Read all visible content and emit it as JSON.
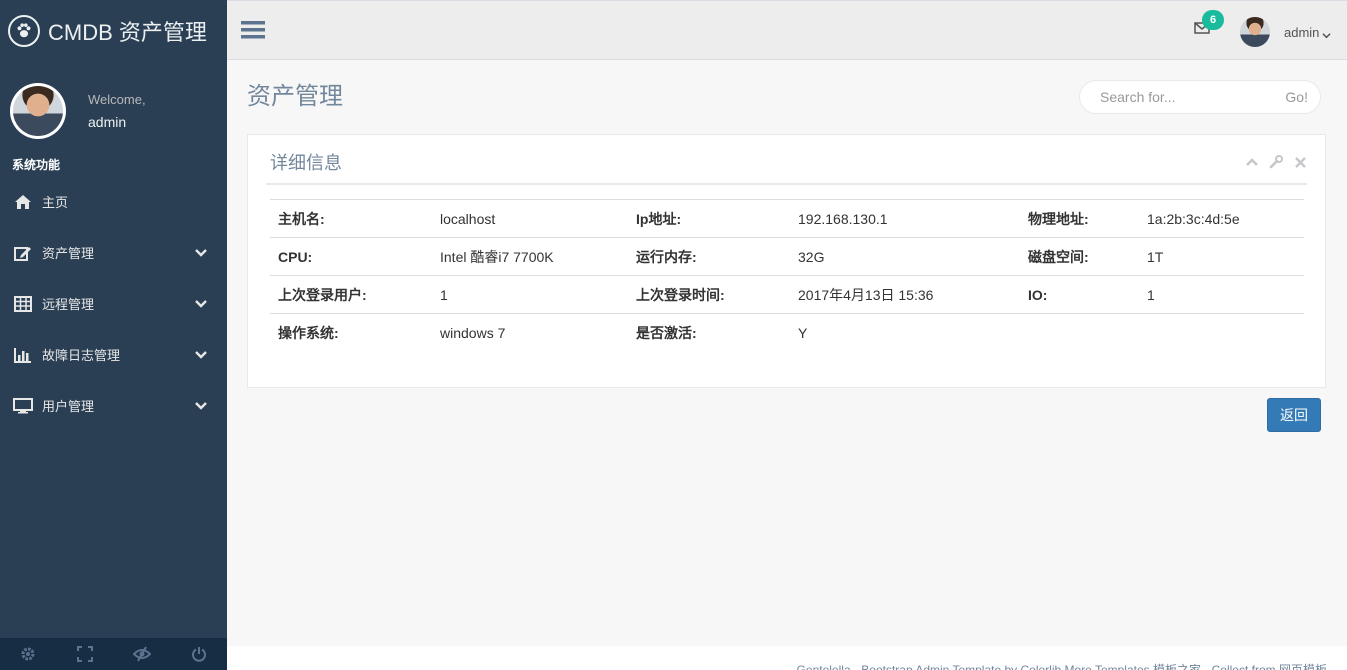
{
  "brand": {
    "title": "CMDB 资产管理",
    "logo_icon": "paw-icon"
  },
  "profile": {
    "welcome": "Welcome,",
    "name": "admin"
  },
  "sidebar": {
    "section_title": "系统功能",
    "items": [
      {
        "label": "主页",
        "icon": "home-icon",
        "has_chevron": false
      },
      {
        "label": "资产管理",
        "icon": "edit-icon",
        "has_chevron": true
      },
      {
        "label": "远程管理",
        "icon": "table-icon",
        "has_chevron": true
      },
      {
        "label": "故障日志管理",
        "icon": "bar-chart-icon",
        "has_chevron": true
      },
      {
        "label": "用户管理",
        "icon": "desktop-icon",
        "has_chevron": true
      }
    ],
    "footer_icons": [
      "settings-icon",
      "fullscreen-icon",
      "eye-slash-icon",
      "power-icon"
    ]
  },
  "topnav": {
    "badge_count": "6",
    "user": "admin"
  },
  "page": {
    "title": "资产管理"
  },
  "search": {
    "placeholder": "Search for...",
    "button": "Go!"
  },
  "panel": {
    "title": "详细信息",
    "rows": [
      [
        {
          "k": "主机名:",
          "v": "localhost"
        },
        {
          "k": "Ip地址:",
          "v": "192.168.130.1"
        },
        {
          "k": "物理地址:",
          "v": "1a:2b:3c:4d:5e"
        }
      ],
      [
        {
          "k": "CPU:",
          "v": "Intel 酷睿i7 7700K"
        },
        {
          "k": "运行内存:",
          "v": "32G"
        },
        {
          "k": "磁盘空间:",
          "v": "1T"
        }
      ],
      [
        {
          "k": "上次登录用户:",
          "v": "1"
        },
        {
          "k": "上次登录时间:",
          "v": "2017年4月13日 15:36"
        },
        {
          "k": "IO:",
          "v": "1"
        }
      ],
      [
        {
          "k": "操作系统:",
          "v": "windows 7"
        },
        {
          "k": "是否激活:",
          "v": "Y"
        },
        {
          "k": "",
          "v": ""
        }
      ]
    ]
  },
  "back_button": "返回",
  "footer": {
    "text": "Gentelella - Bootstrap Admin Template by Colorlib  More Templates 模板之家 - Collect from 网页模板"
  },
  "colors": {
    "sidebar": "#2a3f54",
    "accent": "#1abb9c",
    "primary_button": "#337ab7"
  }
}
